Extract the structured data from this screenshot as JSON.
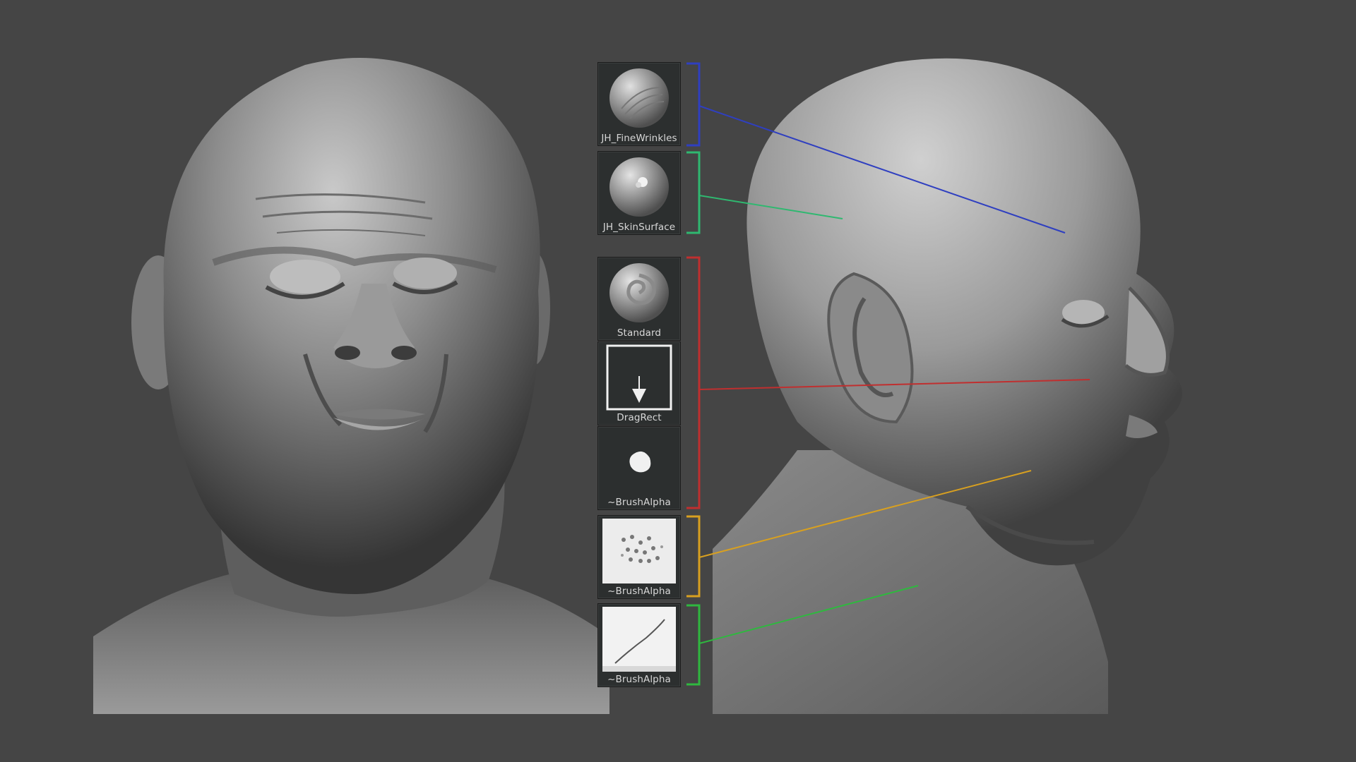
{
  "brushes": [
    {
      "label": "JH_FineWrinkles",
      "icon": "sphere-wrinkles-icon",
      "bracket_color": "#2f3fc0"
    },
    {
      "label": "JH_SkinSurface",
      "icon": "sphere-skin-icon",
      "bracket_color": "#2fb870"
    },
    {
      "label": "Standard",
      "icon": "sphere-swirl-icon",
      "bracket_color": "#c02f2f"
    },
    {
      "label": "DragRect",
      "icon": "dragrect-arrow-icon",
      "bracket_color": "#c02f2f"
    },
    {
      "label": "~BrushAlpha",
      "icon": "blob-alpha-icon",
      "bracket_color": "#c02f2f"
    },
    {
      "label": "~BrushAlpha",
      "icon": "pores-alpha-icon",
      "bracket_color": "#d8a020"
    },
    {
      "label": "~BrushAlpha",
      "icon": "line-alpha-icon",
      "bracket_color": "#2fb83f"
    }
  ],
  "colors": {
    "background": "#454545",
    "blue": "#2f3fc0",
    "teal": "#2fb870",
    "red": "#c02f2f",
    "yellow": "#d8a020",
    "green": "#2fb83f"
  }
}
